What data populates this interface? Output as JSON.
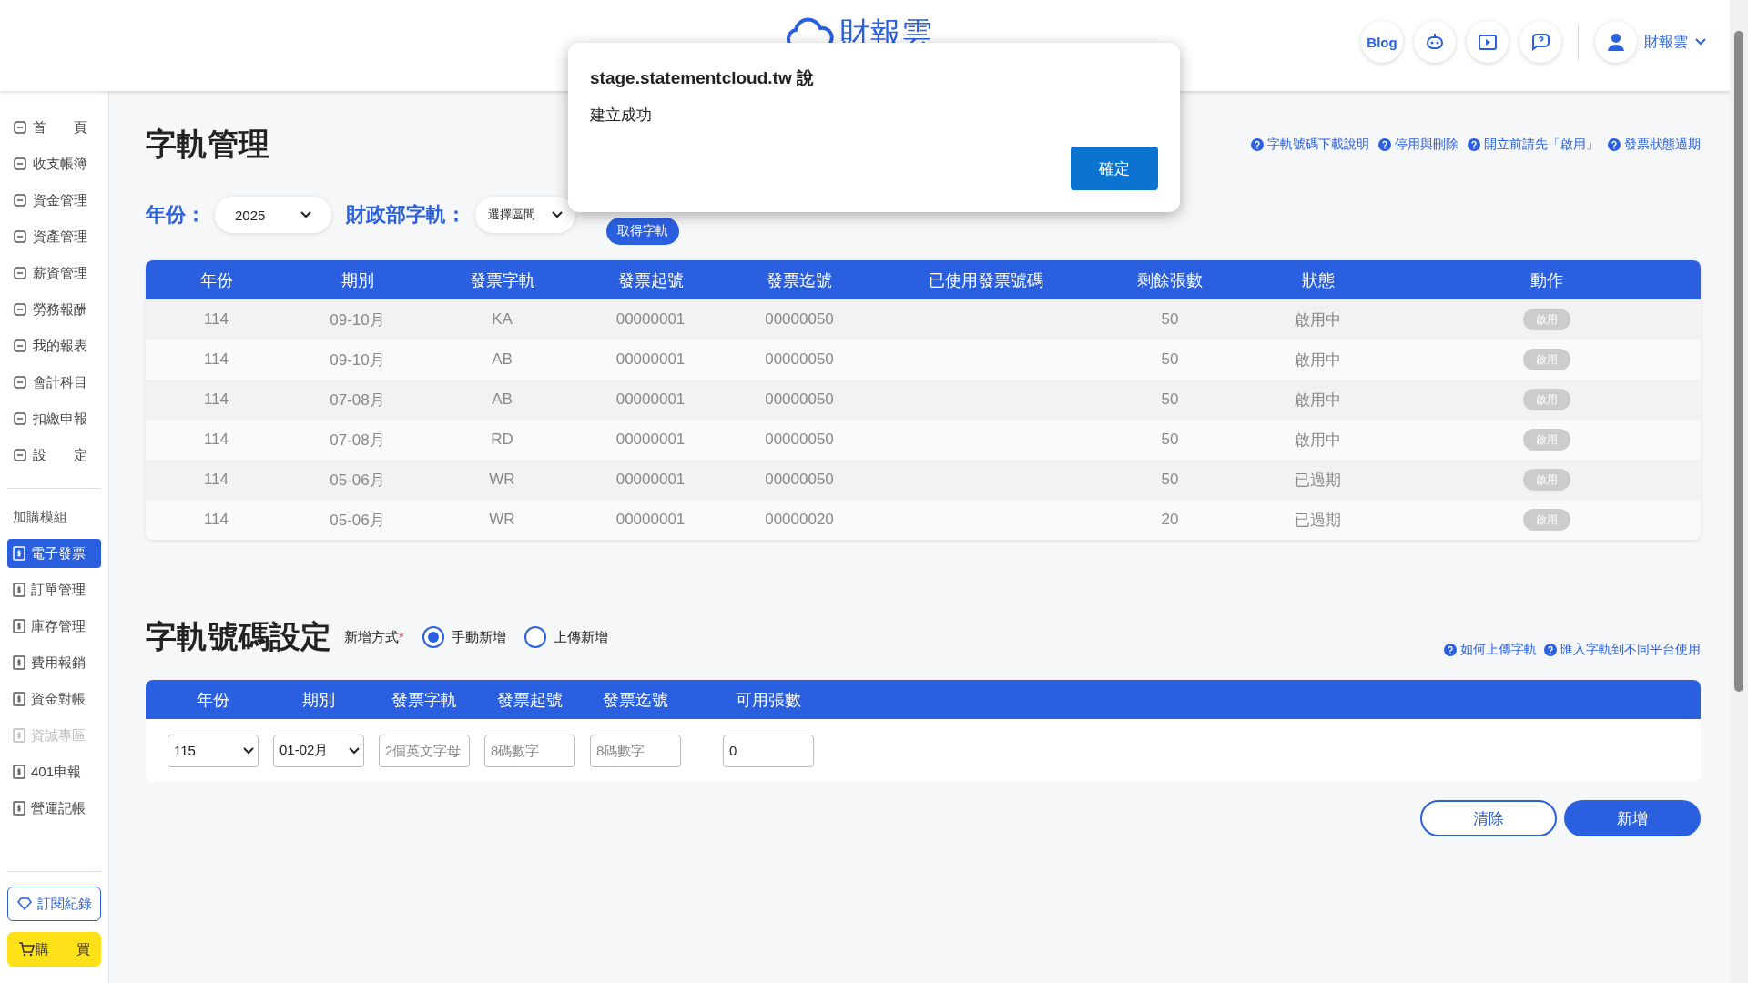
{
  "header": {
    "logo_text": "財報雲",
    "blog_label": "Blog",
    "user_name": "財報雲"
  },
  "sidebar": {
    "items": [
      {
        "label": "首　　頁",
        "kind": "main",
        "selected": false,
        "disabled": false
      },
      {
        "label": "收支帳簿",
        "kind": "main",
        "selected": false,
        "disabled": false
      },
      {
        "label": "資金管理",
        "kind": "main",
        "selected": false,
        "disabled": false
      },
      {
        "label": "資產管理",
        "kind": "main",
        "selected": false,
        "disabled": false
      },
      {
        "label": "薪資管理",
        "kind": "main",
        "selected": false,
        "disabled": false
      },
      {
        "label": "勞務報酬",
        "kind": "main",
        "selected": false,
        "disabled": false
      },
      {
        "label": "我的報表",
        "kind": "main",
        "selected": false,
        "disabled": false
      },
      {
        "label": "會計科目",
        "kind": "main",
        "selected": false,
        "disabled": false
      },
      {
        "label": "扣繳申報",
        "kind": "main",
        "selected": false,
        "disabled": false
      },
      {
        "label": "設　　定",
        "kind": "main",
        "selected": false,
        "disabled": false
      }
    ],
    "section_label": "加購模組",
    "modules": [
      {
        "label": "電子發票",
        "selected": true,
        "disabled": false
      },
      {
        "label": "訂單管理",
        "selected": false,
        "disabled": false
      },
      {
        "label": "庫存管理",
        "selected": false,
        "disabled": false
      },
      {
        "label": "費用報銷",
        "selected": false,
        "disabled": false
      },
      {
        "label": "資金對帳",
        "selected": false,
        "disabled": false
      },
      {
        "label": "資誠專區",
        "selected": false,
        "disabled": true
      },
      {
        "label": "401申報",
        "selected": false,
        "disabled": false
      },
      {
        "label": "營運記帳",
        "selected": false,
        "disabled": false
      }
    ],
    "subscription_button": "訂閱紀錄",
    "buy_button": "購　　買"
  },
  "page": {
    "title": "字軌管理",
    "help_links": [
      "字軌號碼下載說明",
      "停用與刪除",
      "開立前請先「啟用」",
      "發票狀態過期"
    ],
    "year_label": "年份：",
    "year_value": "2025",
    "mof_label": "財政部字軌：",
    "mof_value": "選擇區間",
    "fetch_button": "取得字軌"
  },
  "table": {
    "columns": [
      "年份",
      "期別",
      "發票字軌",
      "發票起號",
      "發票迄號",
      "已使用發票號碼",
      "剩餘張數",
      "狀態",
      "動作"
    ],
    "rows": [
      {
        "year": "114",
        "period": "09-10月",
        "track": "KA",
        "start": "00000001",
        "end": "00000050",
        "remaining": "50",
        "status": "啟用中",
        "action": "啟用",
        "action_disabled": true
      },
      {
        "year": "114",
        "period": "09-10月",
        "track": "AB",
        "start": "00000001",
        "end": "00000050",
        "remaining": "50",
        "status": "啟用中",
        "action": "啟用",
        "action_disabled": true
      },
      {
        "year": "114",
        "period": "07-08月",
        "track": "AB",
        "start": "00000001",
        "end": "00000050",
        "remaining": "50",
        "status": "啟用中",
        "action": "啟用",
        "action_disabled": true
      },
      {
        "year": "114",
        "period": "07-08月",
        "track": "RD",
        "start": "00000001",
        "end": "00000050",
        "remaining": "50",
        "status": "啟用中",
        "action": "啟用",
        "action_disabled": true
      },
      {
        "year": "114",
        "period": "05-06月",
        "track": "WR",
        "start": "00000001",
        "end": "00000050",
        "remaining": "50",
        "status": "已過期",
        "action": "啟用",
        "action_disabled": true
      },
      {
        "year": "114",
        "period": "05-06月",
        "track": "WR",
        "start": "00000001",
        "end": "00000020",
        "remaining": "20",
        "status": "已過期",
        "action": "啟用",
        "action_disabled": true
      }
    ]
  },
  "settings": {
    "title": "字軌號碼設定",
    "method_label": "新增方式",
    "required_mark": "*",
    "methods": [
      {
        "label": "手動新增",
        "selected": true
      },
      {
        "label": "上傳新增",
        "selected": false
      }
    ],
    "help_links": [
      "如何上傳字軌",
      "匯入字軌到不同平台使用"
    ],
    "columns": [
      "年份",
      "期別",
      "發票字軌",
      "發票起號",
      "發票迄號",
      "可用張數"
    ],
    "fields": [
      {
        "kind": "select",
        "value": "115"
      },
      {
        "kind": "select",
        "value": "01-02月"
      },
      {
        "kind": "input",
        "placeholder": "2個英文字母"
      },
      {
        "kind": "input",
        "placeholder": "8碼數字"
      },
      {
        "kind": "input",
        "placeholder": "8碼數字"
      },
      {
        "kind": "input",
        "value": "0"
      }
    ],
    "clear_button": "清除",
    "add_button": "新增"
  },
  "dialog": {
    "title": "stage.statementcloud.tw 說",
    "message": "建立成功",
    "ok_button": "確定"
  }
}
